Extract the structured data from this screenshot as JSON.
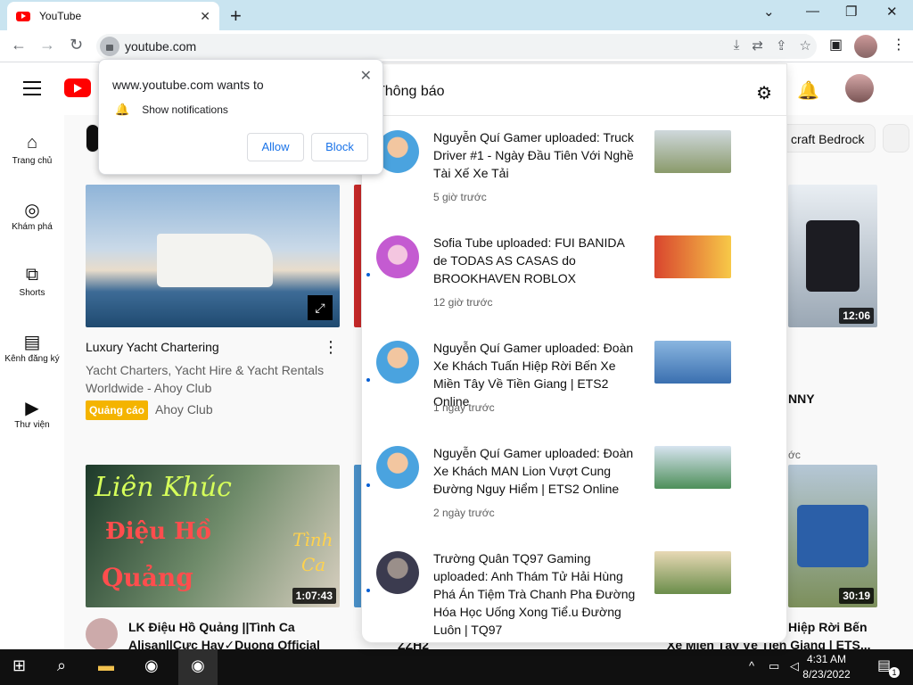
{
  "browser": {
    "tab_title": "YouTube",
    "tab_close": "✕",
    "new_tab": "+",
    "url": "youtube.com",
    "window_controls": [
      "⌄",
      "—",
      "❐",
      "✕"
    ]
  },
  "permission_popup": {
    "title": "www.youtube.com wants to",
    "request": "Show notifications",
    "allow_label": "Allow",
    "block_label": "Block",
    "close": "✕"
  },
  "sidebar": {
    "items": [
      {
        "label": "Trang chủ",
        "icon": "home-icon"
      },
      {
        "label": "Khám phá",
        "icon": "explore-icon"
      },
      {
        "label": "Shorts",
        "icon": "shorts-icon"
      },
      {
        "label": "Kênh đăng ký",
        "icon": "subscriptions-icon"
      },
      {
        "label": "Thư viện",
        "icon": "library-icon"
      }
    ]
  },
  "chips": {
    "visible_right": "craft Bedrock"
  },
  "videos": {
    "ad": {
      "title": "Luxury Yacht Chartering",
      "desc": "Yacht Charters, Yacht Hire & Yacht Rentals Worldwide - Ahoy Club",
      "badge": "Quảng cáo",
      "channel": "Ahoy Club"
    },
    "right_top": {
      "duration": "12:06",
      "title_fragment": "NNY",
      "meta_fragment": "ớc"
    },
    "left_bottom": {
      "duration": "1:07:43",
      "title": "LK Điệu Hồ Quảng ||Tình Ca",
      "title_line2": "Alisan||Cực Hay✓Duong Official",
      "thumb_text_1": "Liên Khúc",
      "thumb_text_2": "Điệu Hồ",
      "thumb_text_3": "Quảng",
      "thumb_text_4": "Tình",
      "thumb_text_5": "Ca"
    },
    "right_bottom": {
      "duration": "30:19",
      "title_fragment": "Hiệp Rời Bến",
      "title_fragment2": "Xe Miền Tây Về Tiền Giang | ETS..."
    },
    "middle_bottom_fragment": "ZZH2"
  },
  "notifications": {
    "title": "Thông báo",
    "items": [
      {
        "text": "Nguyễn Quí Gamer uploaded: Truck Driver #1 - Ngày Đầu Tiên Với Nghề Tài Xế Xe Tải",
        "time": "5 giờ trước",
        "av_color": "#4aa3df",
        "thumb_color": "#8a9a6a"
      },
      {
        "text": "Sofia Tube uploaded: FUI BANIDA de TODAS AS CASAS do BROOKHAVEN ROBLOX",
        "time": "12 giờ trước",
        "av_color": "#c45bd1",
        "thumb_color": "#d9452e"
      },
      {
        "text": "Nguyễn Quí Gamer uploaded: Đoàn Xe Khách Tuấn Hiệp Rời Bến Xe Miền Tây Về Tiền Giang | ETS2 Online",
        "time": "1 ngày trước",
        "av_color": "#4aa3df",
        "thumb_color": "#3a6fb0"
      },
      {
        "text": "Nguyễn Quí Gamer uploaded: Đoàn Xe Khách MAN Lion Vượt Cung Đường Nguy Hiểm | ETS2 Online",
        "time": "2 ngày trước",
        "av_color": "#4aa3df",
        "thumb_color": "#4e8f5a"
      },
      {
        "text": "Trường Quân TQ97 Gaming uploaded: Anh Thám Tử Hải Hùng Phá Án Tiệm Trà Chanh Pha Đường Hóa Học Uống Xong Tiể.u Đường Luôn | TQ97",
        "time": "",
        "av_color": "#3b3b4f",
        "thumb_color": "#6a8d4a"
      }
    ]
  },
  "taskbar": {
    "time": "4:31 AM",
    "date": "8/23/2022",
    "notification_count": "1"
  },
  "colors": {
    "accent": "#1a73e8",
    "yt_red": "#ff0000",
    "ad_badge": "#f4b400"
  }
}
